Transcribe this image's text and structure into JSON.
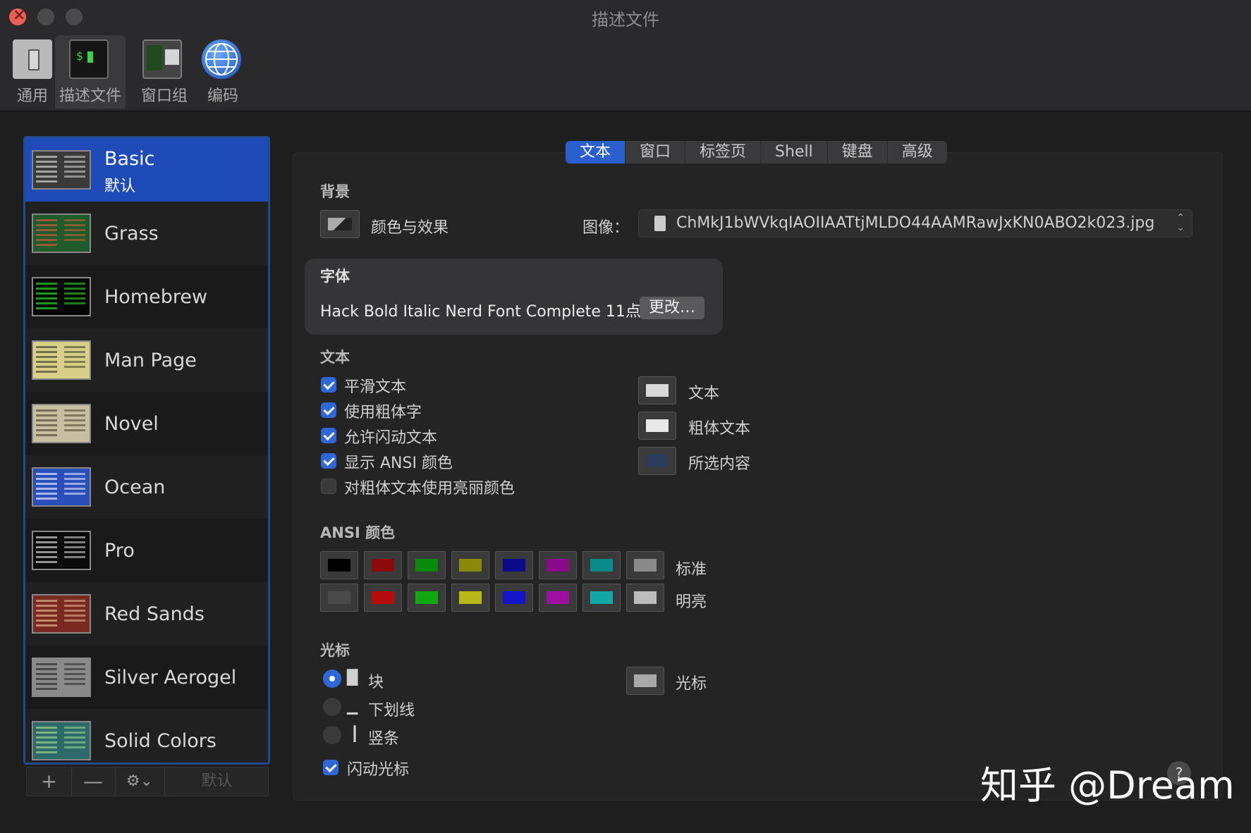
{
  "window": {
    "title": "描述文件"
  },
  "toolbar": [
    {
      "label": "通用",
      "icon": "general-icon"
    },
    {
      "label": "描述文件",
      "icon": "profiles-icon"
    },
    {
      "label": "窗口组",
      "icon": "window-groups-icon"
    },
    {
      "label": "编码",
      "icon": "globe-icon"
    }
  ],
  "profiles": [
    {
      "name": "Basic",
      "sub": "默认",
      "color": "#cfcfcf"
    },
    {
      "name": "Grass",
      "color": "#3e9a3e"
    },
    {
      "name": "Homebrew",
      "color": "#2bd42b"
    },
    {
      "name": "Man Page",
      "color": "#d8d06a"
    },
    {
      "name": "Novel",
      "color": "#b7ad8a"
    },
    {
      "name": "Ocean",
      "color": "#3d63d0"
    },
    {
      "name": "Pro",
      "color": "#cccccc"
    },
    {
      "name": "Red Sands",
      "color": "#b04a3a"
    },
    {
      "name": "Silver Aerogel",
      "color": "#9d9d9d"
    },
    {
      "name": "Solid Colors",
      "color": "#4f8f6a"
    }
  ],
  "list_buttons": {
    "add": "+",
    "remove": "—",
    "gear": "⚙︎⌄",
    "default": "默认"
  },
  "tabs": [
    "文本",
    "窗口",
    "标签页",
    "Shell",
    "键盘",
    "高级"
  ],
  "background": {
    "section": "背景",
    "color_effects": "颜色与效果",
    "image_label": "图像：",
    "image_file": "ChMkJ1bWVkqIAOIIAATtjMLDO44AAMRawJxKN0ABO2k023.jpg"
  },
  "font": {
    "section": "字体",
    "value": "Hack Bold Italic Nerd Font Complete 11点",
    "change_button": "更改…"
  },
  "text": {
    "section": "文本",
    "options": [
      {
        "label": "平滑文本",
        "checked": true
      },
      {
        "label": "使用粗体字",
        "checked": true
      },
      {
        "label": "允许闪动文本",
        "checked": true
      },
      {
        "label": "显示 ANSI 颜色",
        "checked": true
      },
      {
        "label": "对粗体文本使用亮丽颜色",
        "checked": false
      }
    ],
    "colors": [
      {
        "label": "文本",
        "color": "#d8d8d8"
      },
      {
        "label": "粗体文本",
        "color": "#e8e8e8"
      },
      {
        "label": "所选内容",
        "color": "#2a3c5a"
      }
    ]
  },
  "ansi": {
    "section": "ANSI 颜色",
    "normal_label": "标准",
    "bright_label": "明亮",
    "normal": [
      "#000000",
      "#8b0a0a",
      "#0a8a0a",
      "#8a8a0a",
      "#0a0a8a",
      "#8a0a8a",
      "#0a8a8a",
      "#8a8a8a"
    ],
    "bright": [
      "#4a4a4a",
      "#b50c0c",
      "#12a812",
      "#b8b816",
      "#1414c8",
      "#a010a0",
      "#12a8a8",
      "#bcbcbc"
    ]
  },
  "cursor": {
    "section": "光标",
    "options": [
      {
        "glyph": "█",
        "label": "块",
        "selected": true
      },
      {
        "glyph": "▁",
        "label": "下划线",
        "selected": false
      },
      {
        "glyph": "┃",
        "label": "竖条",
        "selected": false
      }
    ],
    "blink_label": "闪动光标",
    "blink_checked": true,
    "color_label": "光标",
    "color": "#a8a8a8"
  },
  "watermark": "知乎 @Dream",
  "help": "?"
}
